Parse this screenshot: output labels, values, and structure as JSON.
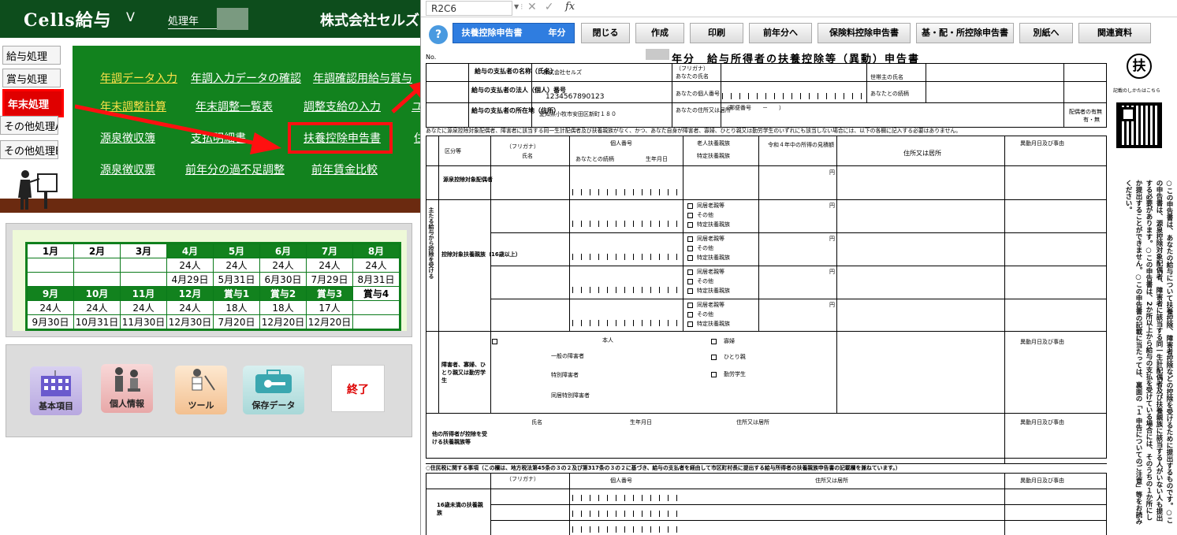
{
  "app": {
    "title": "Cells給与",
    "version_mark": "V",
    "processing_year_label": "処理年",
    "company_name": "株式会社セルズ"
  },
  "sidebar": {
    "items": [
      {
        "label": "給与処理",
        "active": false
      },
      {
        "label": "賞与処理",
        "active": false
      },
      {
        "label": "年末処理",
        "active": true
      },
      {
        "label": "その他処理A",
        "active": false
      },
      {
        "label": "その他処理B",
        "active": false
      }
    ]
  },
  "menu": {
    "row1": [
      "年調データ入力",
      "年調入力データの確認",
      "年調確認用給与賞与"
    ],
    "row2": [
      "年末調整計算",
      "年末調整一覧表",
      "調整支給の入力",
      "ユ"
    ],
    "row3": [
      "源泉徴収簿",
      "支払明細書",
      "扶養控除申告書",
      "住"
    ],
    "row4": [
      "源泉徴収票",
      "前年分の過不足調整",
      "前年賃金比較"
    ]
  },
  "calendar": {
    "row1_months": [
      "1月",
      "2月",
      "3月",
      "4月",
      "5月",
      "6月",
      "7月",
      "8月"
    ],
    "row1_counts": [
      "",
      "",
      "",
      "24人",
      "24人",
      "24人",
      "24人",
      "24人"
    ],
    "row1_dates": [
      "",
      "",
      "",
      "4月29日",
      "5月31日",
      "6月30日",
      "7月29日",
      "8月31日"
    ],
    "row2_months": [
      "9月",
      "10月",
      "11月",
      "12月",
      "賞与1",
      "賞与2",
      "賞与3",
      "賞与4"
    ],
    "row2_counts": [
      "24人",
      "24人",
      "24人",
      "24人",
      "18人",
      "18人",
      "17人",
      ""
    ],
    "row2_dates": [
      "9月30日",
      "10月31日",
      "11月30日",
      "12月30日",
      "7月20日",
      "12月20日",
      "12月20日",
      ""
    ]
  },
  "bottom_buttons": {
    "basic": "基本項目",
    "personal": "個人情報",
    "tool": "ツール",
    "save": "保存データ",
    "end": "終了"
  },
  "sheet": {
    "cell_ref": "R2C6",
    "fx": "fx",
    "toolbar": {
      "help": "?",
      "form_year": "扶養控除申告書　　　年分",
      "close": "閉じる",
      "create": "作成",
      "print": "印刷",
      "prev_year": "前年分へ",
      "insurance": "保険料控除申告書",
      "basic_spouse": "基・配・所控除申告書",
      "other_sheet": "別紙へ",
      "related": "関連資料"
    },
    "form": {
      "no": "No.",
      "title": "年分　給与所得者の扶養控除等（異動）申告書",
      "fuyo_mark": "扶",
      "hint": "記載のしかたはこちら",
      "employer_label": "給与の支払者の名称（氏名）",
      "employer_name": "株式会社セルズ",
      "corp_no_label": "給与の支払者の法人（個人）番号",
      "corp_no": "1234567890123",
      "address_label": "給与の支払者の所在地（住所）",
      "address": "愛知県小牧市安田区新町１８０",
      "furigana": "（フリガナ）",
      "your_name": "あなたの氏名",
      "your_no": "あなたの個人番号",
      "householder": "世帯主の氏名",
      "relationship": "あなたとの続柄",
      "your_address": "あなたの住所又は居所",
      "postcode": "（郵便番号　　－　　）",
      "spouse_status": "配偶者の有無",
      "yes_no": "有・無",
      "notice": "あなたに源泉控除対象配偶者、障害者に該当する同一生計配偶者及び扶養親族がなく、かつ、あなた自身が障害者、寡婦、ひとり親又は勤労学生のいずれにも該当しない場合には、以下の各欄に記入する必要はありません。",
      "kubun": "区分等",
      "name_header": "氏名",
      "personal_no": "個人番号",
      "relation": "あなたとの続柄",
      "birth": "生年月日",
      "old_dependent": "老人扶養親族",
      "specific_dependent": "特定扶養親族",
      "income_estimate": "令和４年中の所得の見積額",
      "address_col": "住所又は居所",
      "change_col": "異動月日及び事由",
      "section_a": "源泉控除対象配偶者",
      "section_b": "控除対象扶養親族（16歳以上）",
      "section_c": "障害者、寡婦、ひとり親又は勤労学生",
      "section_d": "他の所得者が控除を受ける扶養親族等",
      "main_benefit": "主たる給与から控除を受ける",
      "cohabit": "同居老親等",
      "other": "その他",
      "specific": "特定扶養親族",
      "yen": "円",
      "ordinary_disabled": "一般の障害者",
      "special_disabled": "特別障害者",
      "cohabit_special": "同居特別障害者",
      "self": "本人",
      "widow": "寡婦",
      "single_parent": "ひとり親",
      "student": "勤労学生",
      "resident_tax": "○住民税に関する事項（この欄は、地方税法第45条の３の２及び第317条の３の２に基づき、給与の支払者を経由して市区町村長に提出する給与所得者の扶養親族申告書の記載欄を兼ねています。）",
      "under16": "16歳未満の扶養親族",
      "note_vertical": "○この申告書は、あなたの給与について扶養控除、障害者控除などの控除を受けるために提出するものです。○この申告書は、源泉控除対象配偶者、障害者に該当する同一生計配偶者及び扶養親族に該当する人がいない人も提出する必要があります。○この申告書は、2か所以上から給与の支払を受けている場合には、そのうちの１か所にしか提出することができません。○この申告書の記載に当たっては、裏面の「１ 申告についてのご注意」等をお読みください。"
    }
  }
}
